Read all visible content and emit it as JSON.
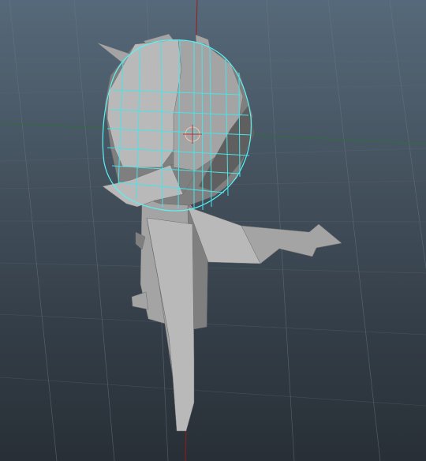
{
  "viewport": {
    "background_top": "#56697a",
    "background_bottom": "#282f36",
    "grid_color": "#6a7784",
    "x_axis_color": "#2e6f3a",
    "y_axis_color": "#a01818",
    "selection_wire_color": "#49e3e8",
    "mesh_color": "#b9b9b9"
  },
  "scene": {
    "model": "low-poly-character",
    "selected_component": "head",
    "pivot_icon": "manipulator-pivot-icon"
  }
}
